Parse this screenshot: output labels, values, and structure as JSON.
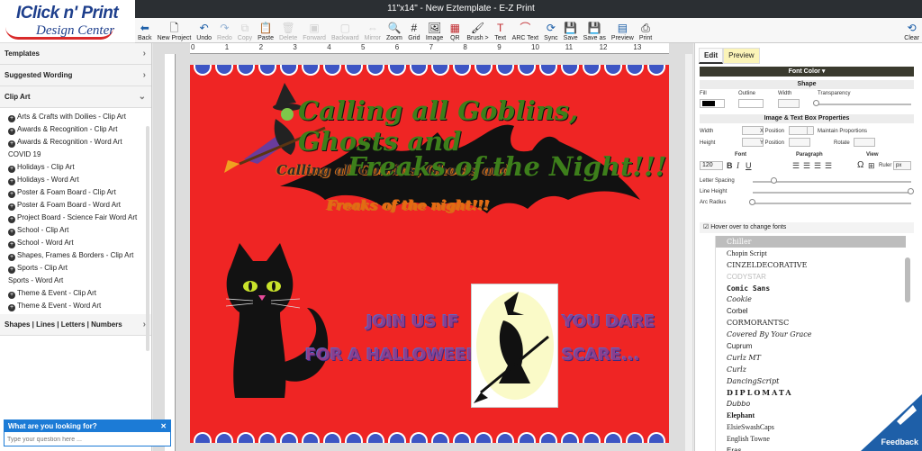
{
  "window": {
    "title": "11\"x14\" - New Eztemplate - E-Z Print"
  },
  "logo": {
    "line1": "IClick n' Print",
    "line2": "Design Center"
  },
  "toolbar": [
    {
      "label": "Back",
      "icon": "back-arrow-icon",
      "state": "enabled"
    },
    {
      "label": "New Project",
      "icon": "new-file-icon",
      "state": "enabled"
    },
    {
      "label": "Undo",
      "icon": "undo-icon",
      "state": "enabled"
    },
    {
      "label": "Redo",
      "icon": "redo-icon",
      "state": "disabled"
    },
    {
      "label": "Copy",
      "icon": "copy-icon",
      "state": "disabled"
    },
    {
      "label": "Paste",
      "icon": "paste-icon",
      "state": "enabled"
    },
    {
      "label": "Delete",
      "icon": "delete-icon",
      "state": "disabled"
    },
    {
      "label": "Forward",
      "icon": "forward-icon",
      "state": "disabled"
    },
    {
      "label": "Backward",
      "icon": "backward-icon",
      "state": "disabled"
    },
    {
      "label": "Mirror",
      "icon": "mirror-icon",
      "state": "disabled"
    },
    {
      "label": "Zoom",
      "icon": "zoom-icon",
      "state": "enabled"
    },
    {
      "label": "Grid",
      "icon": "grid-icon",
      "state": "enabled"
    },
    {
      "label": "Image",
      "icon": "image-icon",
      "state": "enabled"
    },
    {
      "label": "QR",
      "icon": "qr-icon",
      "state": "enabled"
    },
    {
      "label": "Brush >",
      "icon": "brush-icon",
      "state": "enabled"
    },
    {
      "label": "Text",
      "icon": "text-icon",
      "state": "enabled"
    },
    {
      "label": "ARC Text",
      "icon": "arc-text-icon",
      "state": "enabled"
    },
    {
      "label": "Sync",
      "icon": "sync-icon",
      "state": "enabled"
    },
    {
      "label": "Save",
      "icon": "save-icon",
      "state": "enabled"
    },
    {
      "label": "Save as",
      "icon": "save-as-icon",
      "state": "enabled"
    },
    {
      "label": "Preview",
      "icon": "preview-icon",
      "state": "enabled"
    },
    {
      "label": "Print",
      "icon": "print-icon",
      "state": "enabled"
    },
    {
      "label": "Clear",
      "icon": "clear-icon",
      "state": "enabled"
    }
  ],
  "sidebar": {
    "sections": [
      "Templates",
      "Suggested Wording",
      "Clip Art"
    ],
    "clip_art_items": [
      {
        "label": "Arts & Crafts with Doilies - Clip Art",
        "expandable": true
      },
      {
        "label": "Awards & Recognition - Clip Art",
        "expandable": true
      },
      {
        "label": "Awards & Recognition - Word Art",
        "expandable": true
      },
      {
        "label": "COVID 19",
        "expandable": false
      },
      {
        "label": "Holidays - Clip Art",
        "expandable": true
      },
      {
        "label": "Holidays - Word Art",
        "expandable": true
      },
      {
        "label": "Poster & Foam Board - Clip Art",
        "expandable": true
      },
      {
        "label": "Poster & Foam Board - Word Art",
        "expandable": true
      },
      {
        "label": "Project Board - Science Fair Word Art",
        "expandable": true
      },
      {
        "label": "School - Clip Art",
        "expandable": true
      },
      {
        "label": "School - Word Art",
        "expandable": true
      },
      {
        "label": "Shapes, Frames & Borders - Clip Art",
        "expandable": true
      },
      {
        "label": "Sports - Clip Art",
        "expandable": true
      },
      {
        "label": "Sports - Word Art",
        "expandable": false
      },
      {
        "label": "Theme & Event - Clip Art",
        "expandable": true
      },
      {
        "label": "Theme & Event - Word Art",
        "expandable": true
      }
    ],
    "shapes_section": "Shapes | Lines | Letters | Numbers"
  },
  "chat": {
    "title": "What are you looking for?",
    "placeholder": "Type your question here ..."
  },
  "ruler": {
    "marks": [
      "0",
      "1",
      "2",
      "3",
      "4",
      "5",
      "6",
      "7",
      "8",
      "9",
      "10",
      "11",
      "12",
      "13"
    ]
  },
  "canvas": {
    "background": "#ef2524",
    "scallop_color": "#3d55c4",
    "wordart_top_1": "Calling all Goblins, Ghosts and",
    "wordart_top_2": "Freaks of the night!!!",
    "headline_1": "Calling all Goblins, Ghosts and",
    "headline_2": "Freaks of the Night!!!",
    "invite_1a": "JOIN US IF",
    "invite_1b": "YOU DARE",
    "invite_2a": "FOR A HALLOWEEN",
    "invite_2b": "SCARE..."
  },
  "right_panel": {
    "tabs": [
      "Edit",
      "Preview"
    ],
    "font_color_bar": "Font Color",
    "shape_header": "Shape",
    "shape_labels": [
      "Fill",
      "Outline",
      "Width",
      "Transparency"
    ],
    "image_header": "Image & Text Box Properties",
    "image_labels": [
      "Width",
      "X Position",
      "Height",
      "Y Position",
      "Rotate"
    ],
    "maintain_label": "Maintain Proportions",
    "font_headers": [
      "Font",
      "Paragraph",
      "View"
    ],
    "font_size": "120",
    "ruler_label": "Ruler",
    "ruler_unit": "px",
    "spacing_labels": [
      "Letter Spacing",
      "Line Height",
      "Arc Radius"
    ],
    "hover_label": "Hover over to change fonts",
    "fonts": [
      "Chiller",
      "Chopin Script",
      "CINZELDECORATIVE",
      "CODYSTAR",
      "Comic Sans",
      "Cookie",
      "Corbel",
      "CORMORANTSC",
      "Covered By Your Grace",
      "Cuprum",
      "Curlz MT",
      "Curlz",
      "DancingScript",
      "DIPLOMATA",
      "Dubbo",
      "Elephant",
      "ElsieSwashCaps",
      "English Towne",
      "Eras"
    ]
  },
  "feedback": {
    "label": "Feedback"
  }
}
